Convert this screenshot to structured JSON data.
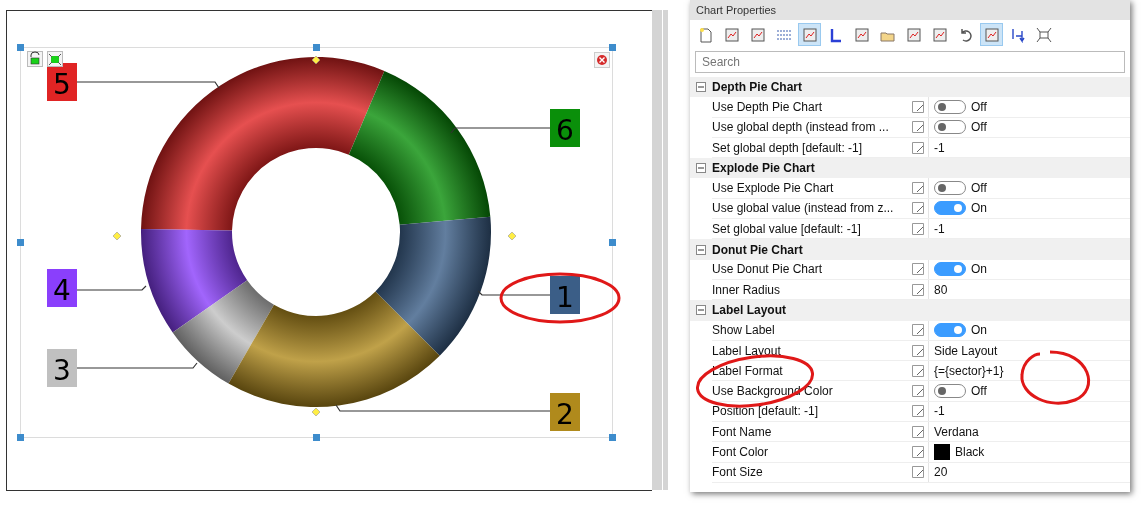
{
  "chart": {
    "labels": [
      {
        "text": "5",
        "color": "#e02424"
      },
      {
        "text": "6",
        "color": "#0a8f0a"
      },
      {
        "text": "4",
        "color": "#8a3ffc"
      },
      {
        "text": "1",
        "color": "#3b5e87"
      },
      {
        "text": "3",
        "color": "#c0c0c0"
      },
      {
        "text": "2",
        "color": "#b08a1c"
      }
    ]
  },
  "panel": {
    "title": "Chart Properties",
    "toolbar": [
      {
        "selected": false
      },
      {
        "selected": false
      },
      {
        "selected": false
      },
      {
        "selected": false
      },
      {
        "selected": true
      },
      {
        "selected": false
      },
      {
        "selected": false
      },
      {
        "selected": false
      },
      {
        "selected": false
      },
      {
        "selected": false
      },
      {
        "selected": false
      },
      {
        "selected": true
      },
      {
        "selected": false
      },
      {
        "selected": false
      }
    ],
    "search": {
      "placeholder": "Search"
    },
    "groups": [
      {
        "title": "Depth Pie Chart",
        "expanded": true,
        "rows": [
          {
            "name": "Use Depth Pie Chart",
            "kind": "toggle",
            "on": false,
            "value": "Off"
          },
          {
            "name": "Use global depth (instead from ...",
            "kind": "toggle",
            "on": false,
            "value": "Off"
          },
          {
            "name": "Set global depth [default: -1]",
            "kind": "text",
            "value": "-1"
          }
        ]
      },
      {
        "title": "Explode Pie Chart",
        "expanded": true,
        "rows": [
          {
            "name": "Use Explode Pie Chart",
            "kind": "toggle",
            "on": false,
            "value": "Off"
          },
          {
            "name": "Use global value (instead from z...",
            "kind": "toggle",
            "on": true,
            "value": "On"
          },
          {
            "name": "Set global value [default: -1]",
            "kind": "text",
            "value": "-1"
          }
        ]
      },
      {
        "title": "Donut Pie Chart",
        "expanded": true,
        "rows": [
          {
            "name": "Use Donut Pie Chart",
            "kind": "toggle",
            "on": true,
            "value": "On"
          },
          {
            "name": "Inner Radius",
            "kind": "text",
            "value": "80"
          }
        ]
      },
      {
        "title": "Label Layout",
        "expanded": true,
        "rows": [
          {
            "name": "Show Label",
            "kind": "toggle",
            "on": true,
            "value": "On"
          },
          {
            "name": "Label Layout",
            "kind": "text",
            "value": "Side Layout"
          },
          {
            "name": "Label Format",
            "kind": "text",
            "value": "{={sector}+1}"
          },
          {
            "name": "Use Background Color",
            "kind": "toggle",
            "on": false,
            "value": "Off"
          },
          {
            "name": "Position [default: -1]",
            "kind": "text",
            "value": "-1"
          },
          {
            "name": "Font Name",
            "kind": "text",
            "value": "Verdana"
          },
          {
            "name": "Font Color",
            "kind": "color",
            "color": "#000000",
            "value": "Black"
          },
          {
            "name": "Font Size",
            "kind": "text",
            "value": "20"
          }
        ]
      }
    ]
  }
}
